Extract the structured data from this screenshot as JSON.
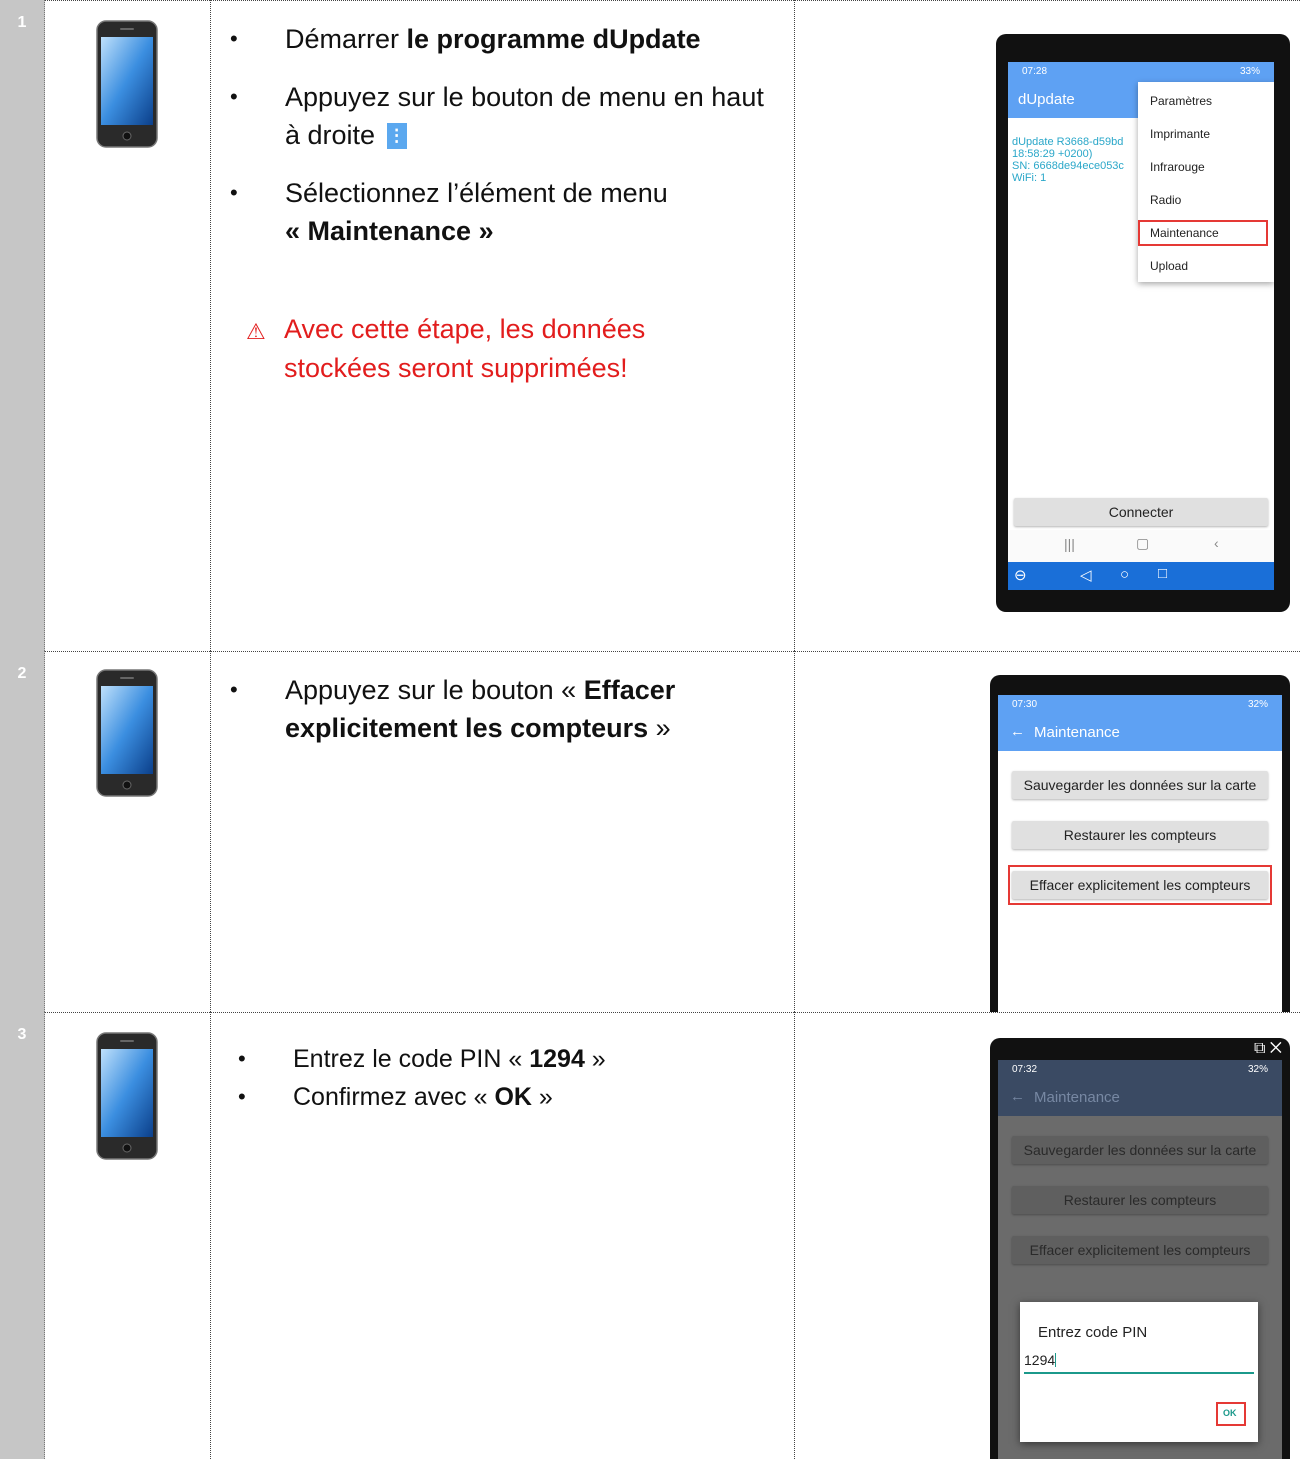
{
  "steps": [
    {
      "number": "1",
      "bullets": {
        "b1_pre": "Démarrer ",
        "b1_bold": "le programme dUpdate",
        "b2": "Appuyez sur le bouton de menu en haut à droite",
        "b3_pre": "Sélectionnez l’élément de menu",
        "b3_bold_open": "« ",
        "b3_bold": "Maintenance",
        "b3_close": " »"
      },
      "warning": "Avec cette étape, les données stockées seront supprimées!",
      "screen": {
        "time": "07:28",
        "status_right": "33%",
        "app_title": "dUpdate",
        "info_lines": [
          "dUpdate R3668-d59bd",
          "18:58:29 +0200)",
          "SN: 6668de94ece053c",
          "WiFi: 1"
        ],
        "menu_items": [
          "Paramètres",
          "Imprimante",
          "Infrarouge",
          "Radio",
          "Maintenance",
          "Upload"
        ],
        "connect_button": "Connecter"
      }
    },
    {
      "number": "2",
      "bullets": {
        "b1_pre": "Appuyez sur le bouton « ",
        "b1_bold": "Effacer explicitement les compteurs",
        "b1_post": " »"
      },
      "screen": {
        "time": "07:30",
        "status_right": "32%",
        "title": "Maintenance",
        "buttons": [
          "Sauvegarder les données sur la carte",
          "Restaurer les compteurs",
          "Effacer explicitement les compteurs"
        ]
      }
    },
    {
      "number": "3",
      "bullets": {
        "b1_pre": "Entrez le code PIN « ",
        "b1_bold": "1294",
        "b1_post": " »",
        "b2_pre": "Confirmez avec « ",
        "b2_bold": "OK",
        "b2_post": " »"
      },
      "screen": {
        "time": "07:32",
        "status_right": "32%",
        "title": "Maintenance",
        "buttons": [
          "Sauvegarder les données sur la carte",
          "Restaurer les compteurs",
          "Effacer explicitement les compteurs"
        ],
        "dialog_title": "Entrez code PIN",
        "pin_value": "1294",
        "ok_label": "OK",
        "window_controls": "⧉ ✕"
      }
    }
  ],
  "colors": {
    "app_bar": "#5ea1f3",
    "info_text": "#2aa7c9",
    "warning": "#e21d1d",
    "highlight": "#e53935",
    "nav_bar": "#1a6fd8"
  }
}
